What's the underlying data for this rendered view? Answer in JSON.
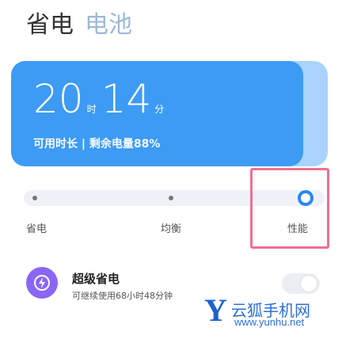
{
  "tabs": {
    "active": "省电",
    "inactive": "电池"
  },
  "card": {
    "hours": "20",
    "hours_unit": "时",
    "minutes": "14",
    "minutes_unit": "分",
    "remaining": "可用时长 | 剩余电量88%"
  },
  "modes": {
    "items": [
      {
        "label": "省电",
        "selected": false
      },
      {
        "label": "均衡",
        "selected": false
      },
      {
        "label": "性能",
        "selected": true
      }
    ]
  },
  "super_saver": {
    "title": "超级省电",
    "subtitle": "可继续使用68小时48分钟",
    "enabled": false
  },
  "watermark": {
    "logo": "Y",
    "text": "云狐手机网",
    "url": "www.yunhu.net"
  },
  "colors": {
    "card": "#3d9bf3",
    "accent": "#2b87f0",
    "highlight": "#ef6f93",
    "icon": "#8a66f5"
  }
}
